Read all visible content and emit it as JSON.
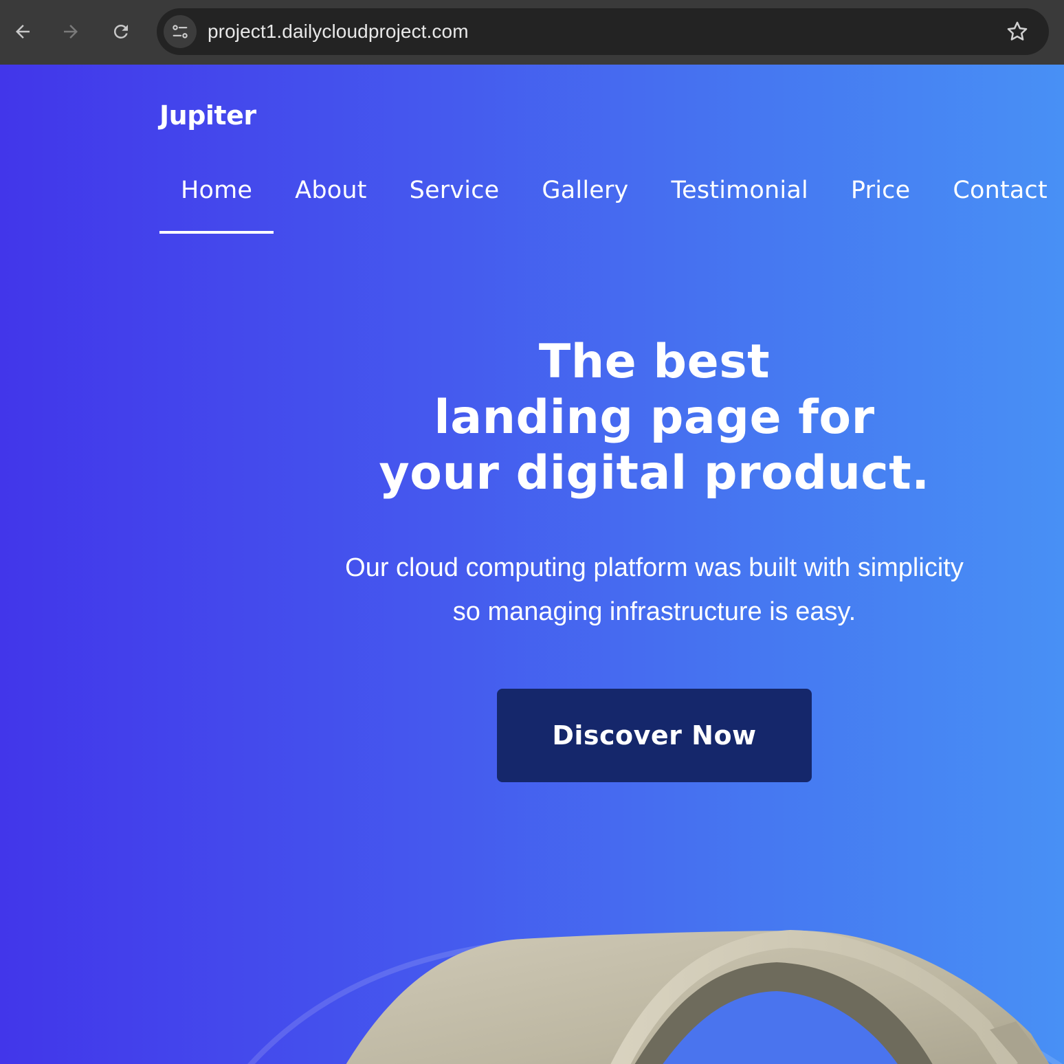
{
  "browser": {
    "url": "project1.dailycloudproject.com",
    "icons": {
      "back": "arrow-left-icon",
      "forward": "arrow-right-icon",
      "reload": "reload-icon",
      "site_info": "tune-icon",
      "bookmark": "star-icon"
    }
  },
  "site": {
    "brand": "Jupiter"
  },
  "nav": {
    "items": [
      {
        "label": "Home",
        "active": true
      },
      {
        "label": "About",
        "active": false
      },
      {
        "label": "Service",
        "active": false
      },
      {
        "label": "Gallery",
        "active": false
      },
      {
        "label": "Testimonial",
        "active": false
      },
      {
        "label": "Price",
        "active": false
      },
      {
        "label": "Contact",
        "active": false
      }
    ]
  },
  "hero": {
    "title_lines": [
      "The best",
      "landing page for",
      "your digital product."
    ],
    "subtitle_lines": [
      "Our cloud computing platform was built with simplicity",
      "so managing infrastructure is easy."
    ],
    "cta_label": "Discover Now",
    "image_subject": "beige-watch-strap-product-image"
  },
  "colors": {
    "gradient_start": "#4236ea",
    "gradient_end": "#4890f5",
    "cta_background": "#15276b",
    "text": "#ffffff",
    "browser_chrome": "#3a3a3a",
    "omnibox": "#232323"
  }
}
